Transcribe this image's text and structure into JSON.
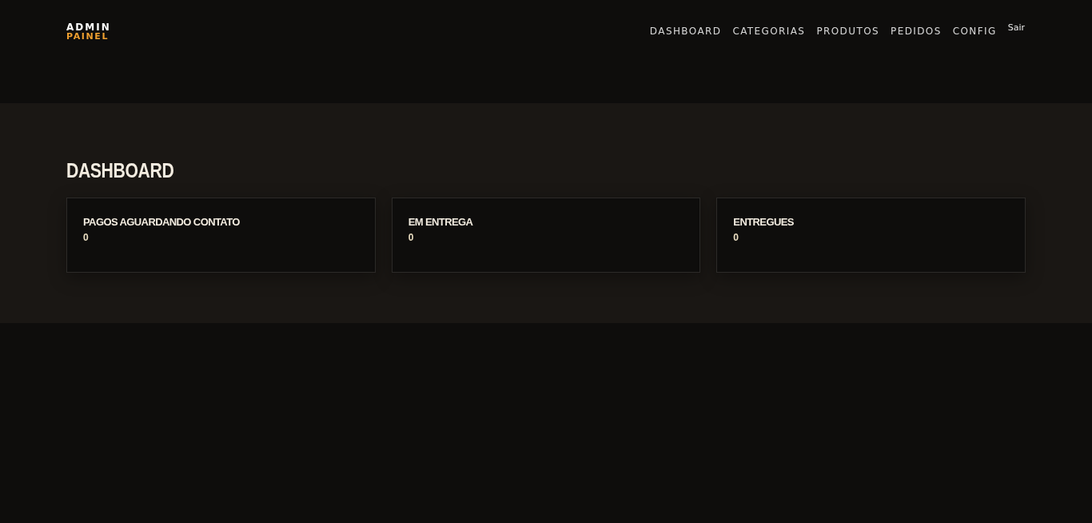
{
  "brand": {
    "line_1": "ADMIN",
    "line_2": "PAINEL"
  },
  "nav": {
    "items": [
      "DASHBOARD",
      "CATEGORIAS",
      "PRODUTOS",
      "PEDIDOS",
      "CONFIG"
    ],
    "logout": "Sair"
  },
  "page_title": "DASHBOARD",
  "stats": [
    {
      "label": "PAGOS AGUARDANDO CONTATO",
      "value": "0"
    },
    {
      "label": "EM ENTREGA",
      "value": "0"
    },
    {
      "label": "ENTREGUES",
      "value": "0"
    }
  ]
}
